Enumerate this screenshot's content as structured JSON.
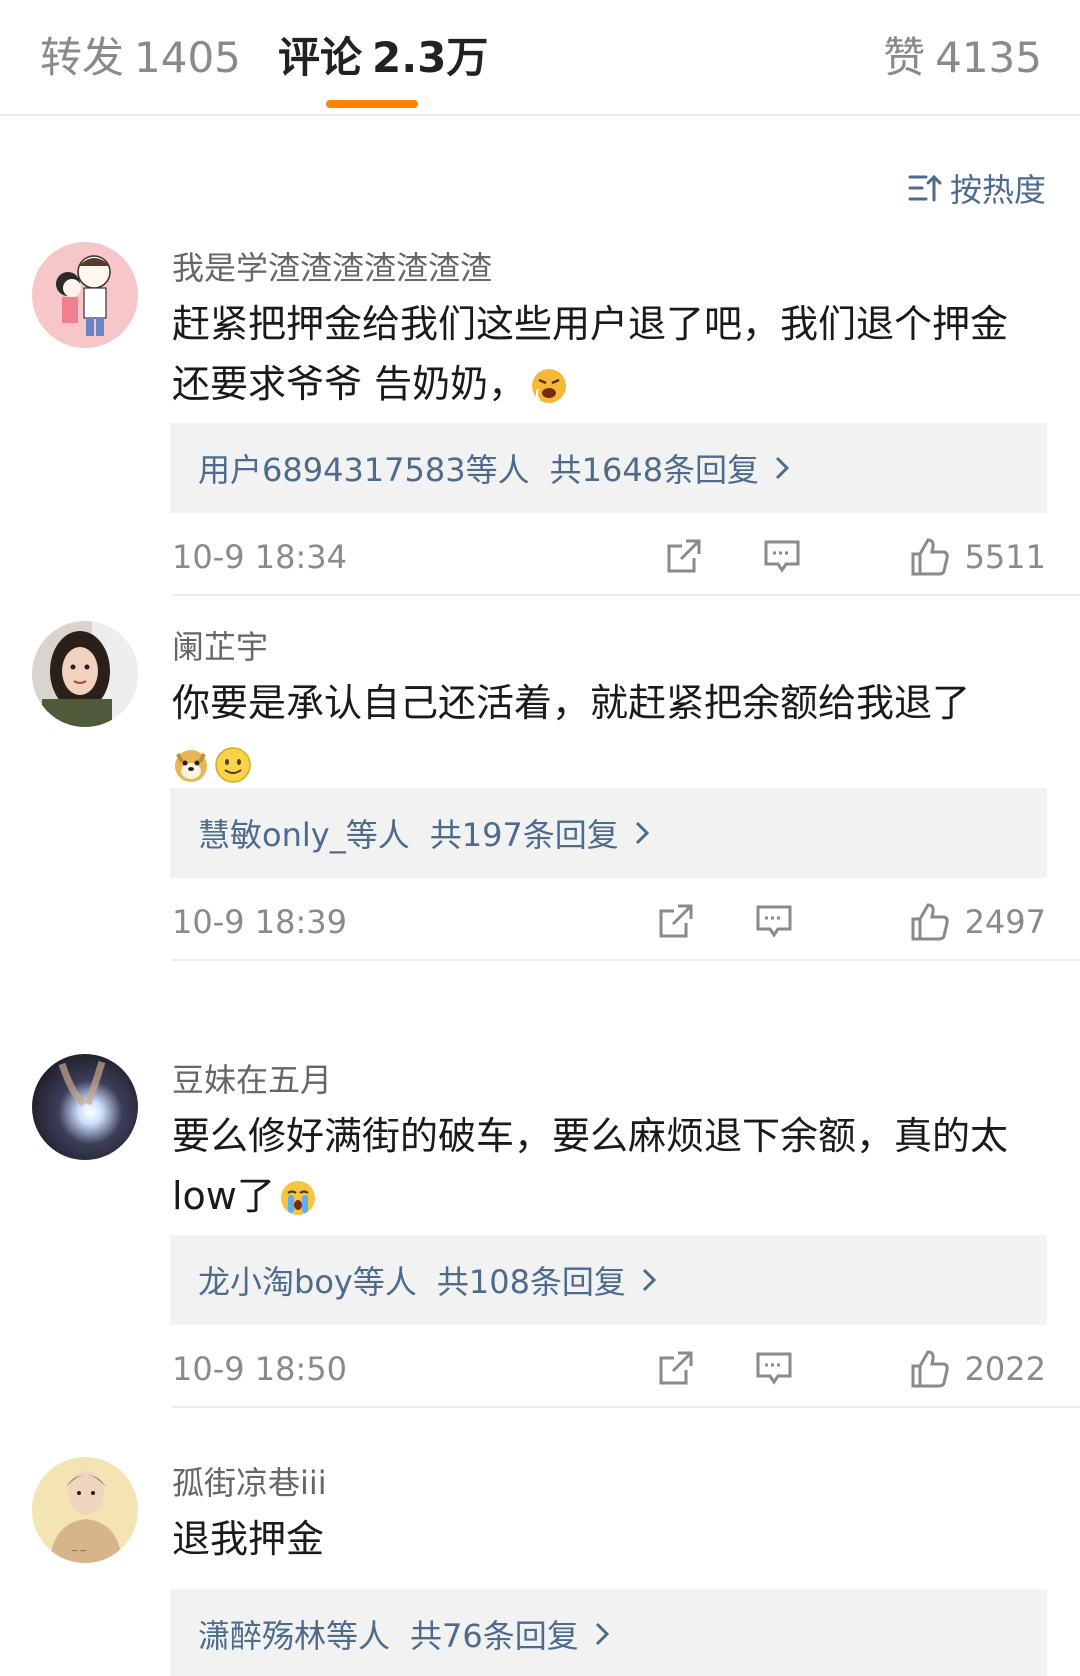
{
  "tabs": {
    "repost": {
      "label": "转发",
      "count": "1405"
    },
    "comments": {
      "label": "评论",
      "count": "2.3万"
    },
    "likes": {
      "label": "赞",
      "count": "4135"
    }
  },
  "sort": {
    "label": "按热度",
    "icon": "sort-icon"
  },
  "colors": {
    "accent": "#ff8200",
    "link": "#4d6b8c",
    "reply_bg": "#f2f2f2"
  },
  "comments": [
    {
      "username": "我是学渣渣渣渣渣渣渣",
      "text": "赶紧把押金给我们这些用户退了吧，我们退个押金还要求爷爷 告奶奶，",
      "emojis": [
        "angry-face-emoji"
      ],
      "replies": {
        "users": "用户6894317583等人",
        "total": "共1648条回复"
      },
      "time": "10-9 18:34",
      "likes": "5511"
    },
    {
      "username": "阑芷宇",
      "text": "你要是承认自己还活着，就赶紧把余额给我退了",
      "emojis": [
        "doge-emoji",
        "smile-emoji"
      ],
      "replies": {
        "users": "慧敏only_等人",
        "total": "共197条回复"
      },
      "time": "10-9 18:39",
      "likes": "2497"
    },
    {
      "username": "豆妹在五月",
      "text": "要么修好满街的破车，要么麻烦退下余额，真的太low了",
      "emojis": [
        "crying-face-emoji"
      ],
      "replies": {
        "users": "龙小淘boy等人",
        "total": "共108条回复"
      },
      "time": "10-9 18:50",
      "likes": "2022"
    },
    {
      "username": "孤街凉巷iii",
      "text": "退我押金",
      "emojis": [],
      "replies": {
        "users": "潇醉殇林等人",
        "total": "共76条回复"
      }
    }
  ]
}
